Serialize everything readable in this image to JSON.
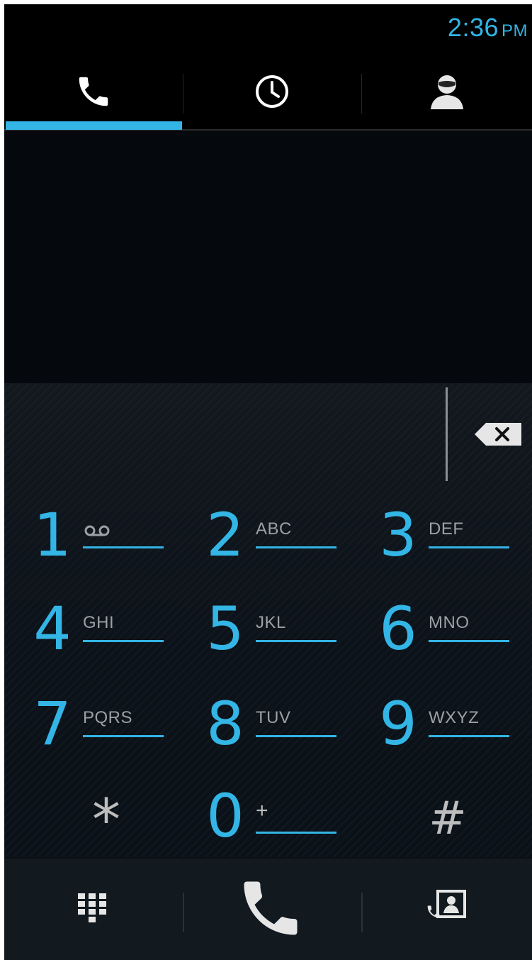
{
  "status_bar": {
    "time": "2:36",
    "ampm": "PM"
  },
  "tabs": [
    {
      "id": "dialer",
      "icon": "phone-icon",
      "selected": true
    },
    {
      "id": "recent",
      "icon": "clock-icon",
      "selected": false
    },
    {
      "id": "contacts",
      "icon": "person-icon",
      "selected": false
    }
  ],
  "dialer": {
    "digits": ""
  },
  "keypad": {
    "keys": [
      {
        "digit": "1",
        "letters": "",
        "icon": "voicemail-icon"
      },
      {
        "digit": "2",
        "letters": "ABC"
      },
      {
        "digit": "3",
        "letters": "DEF"
      },
      {
        "digit": "4",
        "letters": "GHI"
      },
      {
        "digit": "5",
        "letters": "JKL"
      },
      {
        "digit": "6",
        "letters": "MNO"
      },
      {
        "digit": "7",
        "letters": "PQRS"
      },
      {
        "digit": "8",
        "letters": "TUV"
      },
      {
        "digit": "9",
        "letters": "WXYZ"
      },
      {
        "digit": "*",
        "letters": ""
      },
      {
        "digit": "0",
        "letters": "+"
      },
      {
        "digit": "#",
        "letters": ""
      }
    ]
  },
  "action_bar": {
    "buttons": [
      {
        "id": "show-keypad",
        "icon": "dialpad-icon"
      },
      {
        "id": "call",
        "icon": "phone-icon"
      },
      {
        "id": "add-contact",
        "icon": "contact-card-icon"
      }
    ]
  },
  "colors": {
    "accent": "#33b5e5",
    "background": "#000000",
    "keypad_bg": "#0f151b",
    "secondary_text": "#9aa0a6"
  }
}
